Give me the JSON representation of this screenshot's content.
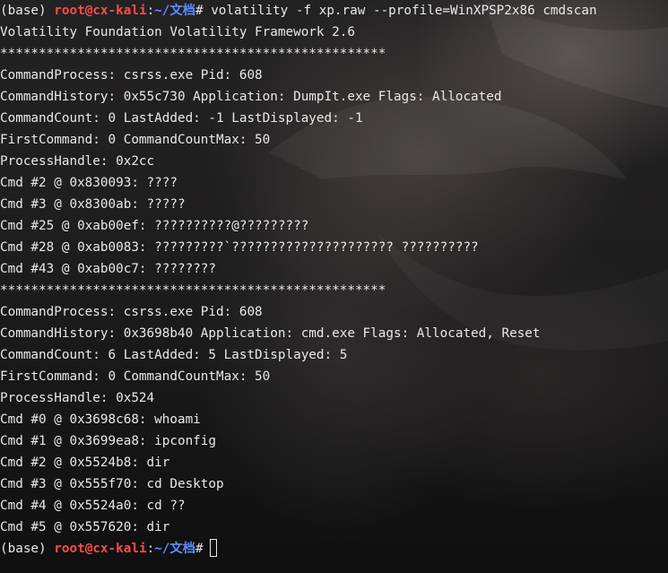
{
  "prompt": {
    "env": "(base) ",
    "user_host": "root@cx-kali",
    "separator": ":",
    "path": "~/文档",
    "symbol": "#"
  },
  "command": " volatility -f xp.raw --profile=WinXPSP2x86 cmdscan",
  "output_lines": [
    "Volatility Foundation Volatility Framework 2.6",
    "**************************************************",
    "CommandProcess: csrss.exe Pid: 608",
    "CommandHistory: 0x55c730 Application: DumpIt.exe Flags: Allocated",
    "CommandCount: 0 LastAdded: -1 LastDisplayed: -1",
    "FirstCommand: 0 CommandCountMax: 50",
    "ProcessHandle: 0x2cc",
    "Cmd #2 @ 0x830093: ????",
    "Cmd #3 @ 0x8300ab: ?????",
    "Cmd #25 @ 0xab00ef: ??????????@?????????",
    "Cmd #28 @ 0xab0083: ?????????`????????????????????? ??????????",
    "Cmd #43 @ 0xab00c7: ????????",
    "**************************************************",
    "CommandProcess: csrss.exe Pid: 608",
    "CommandHistory: 0x3698b40 Application: cmd.exe Flags: Allocated, Reset",
    "CommandCount: 6 LastAdded: 5 LastDisplayed: 5",
    "FirstCommand: 0 CommandCountMax: 50",
    "ProcessHandle: 0x524",
    "Cmd #0 @ 0x3698c68: whoami",
    "Cmd #1 @ 0x3699ea8: ipconfig",
    "Cmd #2 @ 0x5524b8: dir",
    "Cmd #3 @ 0x555f70: cd Desktop",
    "Cmd #4 @ 0x5524a0: cd ??",
    "Cmd #5 @ 0x557620: dir"
  ],
  "colors": {
    "text": "#e8e8e8",
    "user_host": "#ff4b4b",
    "path": "#5c8cff"
  }
}
